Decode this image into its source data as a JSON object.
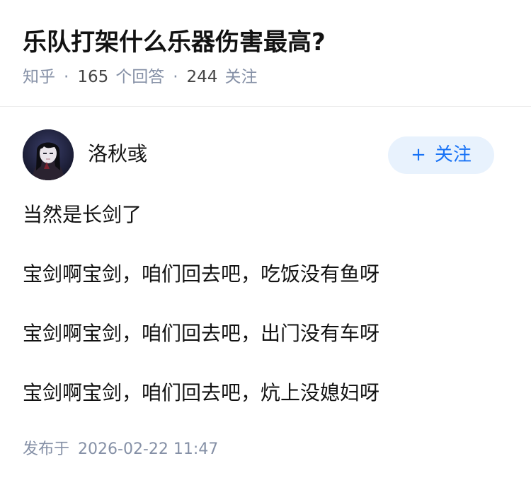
{
  "question": {
    "title": "乐队打架什么乐器伤害最高?",
    "source": "知乎",
    "answer_count": "165",
    "answer_label": "个回答",
    "follower_count": "244",
    "follower_label": "关注"
  },
  "author": {
    "name": "洛秋彧",
    "avatar_icon": "anime-avatar-icon",
    "follow_icon": "plus-icon",
    "follow_label": "关注"
  },
  "answer": {
    "paragraphs": [
      "当然是长剑了",
      "宝剑啊宝剑，咱们回去吧，吃饭没有鱼呀",
      "宝剑啊宝剑，咱们回去吧，出门没有车呀",
      "宝剑啊宝剑，咱们回去吧，炕上没媳妇呀"
    ],
    "publish_label": "发布于",
    "publish_time": "2026-02-22 11:47"
  },
  "colors": {
    "title": "#121212",
    "meta_gray": "#8590a6",
    "accent_blue": "#1772f6",
    "follow_bg": "#e8f2fd",
    "divider": "#ebebeb"
  }
}
